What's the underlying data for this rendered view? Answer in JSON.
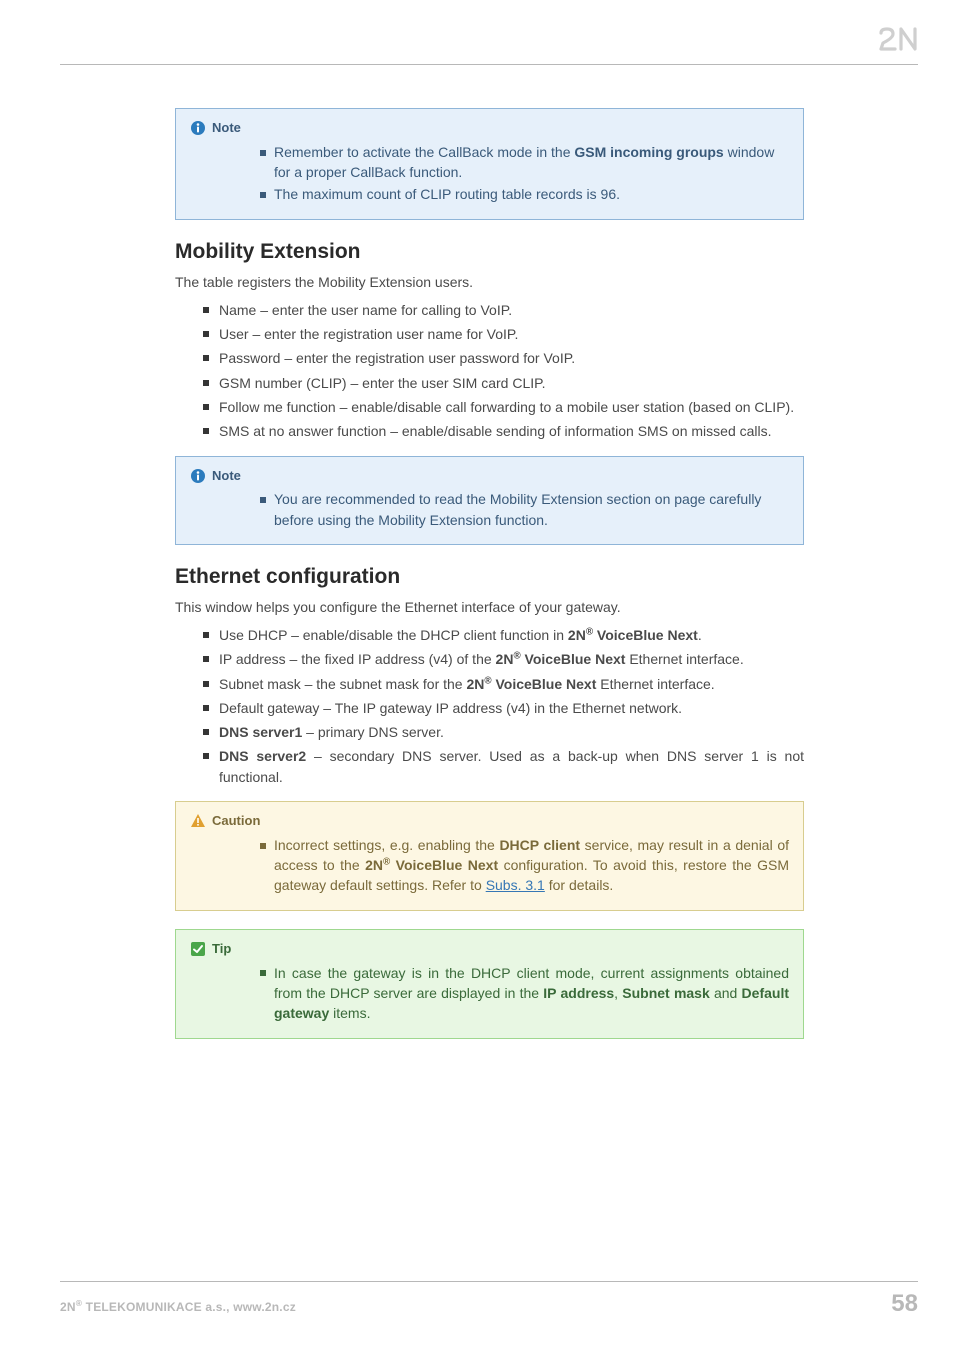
{
  "logo_alt": "2N",
  "note1": {
    "title": "Note",
    "items": [
      {
        "pre": "Remember to activate the CallBack mode in the ",
        "bold": "GSM incoming groups",
        "post": " window for a proper CallBack function."
      },
      {
        "pre": "The maximum count of CLIP routing table records is 96.",
        "bold": "",
        "post": ""
      }
    ]
  },
  "mobility": {
    "heading": "Mobility Extension",
    "intro": "The table registers the Mobility Extension users.",
    "items": [
      "Name – enter the user name for calling to VoIP.",
      "User – enter the registration user name for VoIP.",
      "Password – enter the registration user password for VoIP.",
      "GSM number (CLIP) – enter the user SIM card CLIP.",
      "Follow me function – enable/disable call forwarding to a mobile user station (based on CLIP).",
      "SMS at no answer function – enable/disable sending of information SMS on missed calls."
    ]
  },
  "note2": {
    "title": "Note",
    "items": [
      "You are recommended to read the Mobility Extension section on page carefully before using the Mobility Extension function."
    ]
  },
  "ethernet": {
    "heading": "Ethernet configuration",
    "intro": "This window helps you configure the Ethernet interface of your gateway.",
    "items": {
      "i0": {
        "pre": "Use DHCP – enable/disable the DHCP client function in ",
        "brand": "2N",
        "sup": "®",
        "bold2": " VoiceBlue Next",
        "post": "."
      },
      "i1": {
        "pre": "IP address – the fixed IP address (v4) of the ",
        "brand": "2N",
        "sup": "®",
        "bold2": " VoiceBlue Next",
        "post": " Ethernet interface."
      },
      "i2": {
        "pre": "Subnet mask – the subnet mask for the ",
        "brand": "2N",
        "sup": "®",
        "bold2": " VoiceBlue Next",
        "post": " Ethernet interface."
      },
      "i3": {
        "pre": "Default gateway – The IP gateway IP address (v4) in the Ethernet network.",
        "brand": "",
        "sup": "",
        "bold2": "",
        "post": ""
      },
      "i4": {
        "bold0": "DNS server1",
        "post": " – primary DNS server."
      },
      "i5": {
        "bold0": "DNS server2",
        "post": " – secondary DNS server. Used as a back-up when DNS server 1 is not functional."
      }
    }
  },
  "caution": {
    "title": "Caution",
    "item": {
      "pre": "Incorrect settings, e.g. enabling the ",
      "bold1": "DHCP client",
      "mid1": " service, may result in a denial of access to the ",
      "brand": "2N",
      "sup": "®",
      "bold2": " VoiceBlue Next",
      "mid2": " configuration. To avoid this, restore the GSM gateway default settings. Refer to ",
      "link": "Subs. 3.1",
      "post": " for details."
    }
  },
  "tip": {
    "title": "Tip",
    "item": {
      "pre": "In case the gateway is in the DHCP client mode, current assignments obtained from the DHCP server are displayed in the ",
      "b1": "IP address",
      "s1": ", ",
      "b2": "Subnet mask",
      "s2": " and ",
      "b3": "Default gateway",
      "post": " items."
    }
  },
  "footer": {
    "brand_pre": "2N",
    "brand_sup": "®",
    "brand_post": " TELEKOMUNIKACE a.s., www.2n.cz",
    "page": "58"
  }
}
